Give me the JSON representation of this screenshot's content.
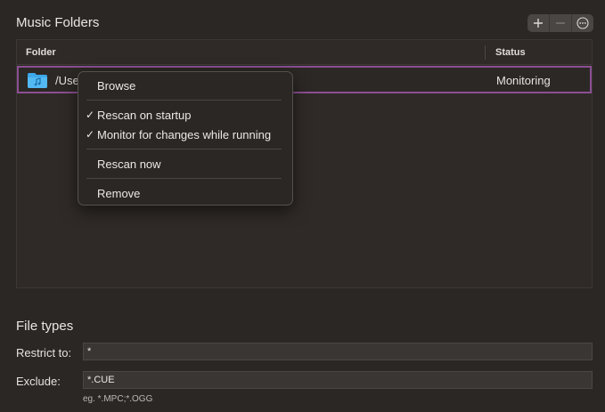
{
  "music_folders": {
    "title": "Music Folders",
    "controls": {
      "add_label": "+",
      "remove_label": "—",
      "more_label": "⋯"
    },
    "columns": {
      "folder": "Folder",
      "status": "Status"
    },
    "rows": [
      {
        "path": "/Use",
        "status": "Monitoring"
      }
    ]
  },
  "context_menu": {
    "items": [
      {
        "label": "Browse",
        "check": ""
      },
      {
        "label": "Rescan on startup",
        "check": "✓"
      },
      {
        "label": "Monitor for changes while running",
        "check": "✓"
      },
      {
        "label": "Rescan now",
        "check": ""
      },
      {
        "label": "Remove",
        "check": ""
      }
    ]
  },
  "file_types": {
    "title": "File types",
    "restrict_label": "Restrict to:",
    "restrict_value": "*",
    "exclude_label": "Exclude:",
    "exclude_value": "*.CUE",
    "hint": "eg. *.MPC;*.OGG"
  },
  "colors": {
    "accent_selection": "#8c4f93",
    "folder_icon": "#3ea8ea",
    "background": "#2b2724"
  }
}
